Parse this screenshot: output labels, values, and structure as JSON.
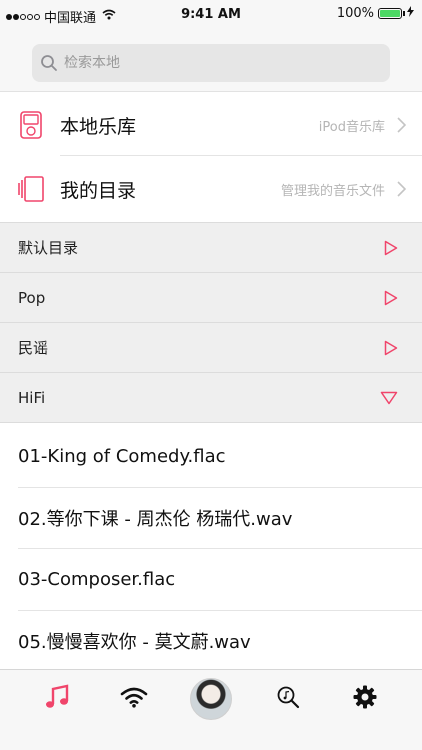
{
  "status_bar": {
    "carrier": "中国联通",
    "time": "9:41 AM",
    "battery": "100%",
    "signal_bars": 2,
    "battery_level": 1.0
  },
  "search": {
    "placeholder": "检索本地"
  },
  "library": {
    "items": [
      {
        "title": "本地乐库",
        "subtitle": "iPod音乐库",
        "icon": "ipod-icon"
      },
      {
        "title": "我的目录",
        "subtitle": "管理我的音乐文件",
        "icon": "folder-stack-icon"
      }
    ]
  },
  "folders": [
    {
      "label": "默认目录",
      "expanded": false
    },
    {
      "label": "Pop",
      "expanded": false
    },
    {
      "label": "民谣",
      "expanded": false
    },
    {
      "label": "HiFi",
      "expanded": true
    }
  ],
  "files": [
    "01-King of Comedy.flac",
    "02.等你下课 - 周杰伦 杨瑞代.wav",
    "03-Composer.flac",
    "05.慢慢喜欢你 - 莫文蔚.wav"
  ],
  "tab_bar": {
    "tabs": [
      {
        "icon": "music-note-icon",
        "active": true
      },
      {
        "icon": "wifi-icon",
        "active": false
      },
      {
        "icon": "avatar",
        "active": false
      },
      {
        "icon": "music-search-icon",
        "active": false
      },
      {
        "icon": "gear-icon",
        "active": false
      }
    ]
  },
  "colors": {
    "accent": "#f0456b",
    "battery": "#4cd964"
  }
}
